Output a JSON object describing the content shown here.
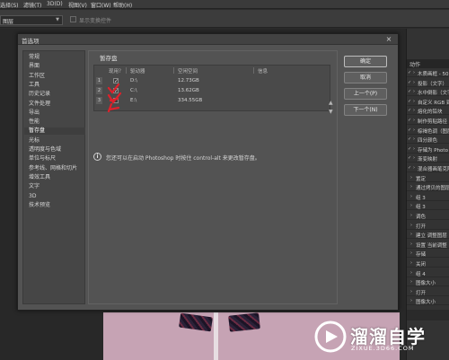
{
  "menubar": {
    "items": [
      "选择(S)",
      "滤镜(T)",
      "3D(D)",
      "视图(V)",
      "窗口(W)",
      "帮助(H)"
    ]
  },
  "options_bar": {
    "layer_select_value": "图层",
    "show_transform_label": "显示变换控件"
  },
  "dialog": {
    "title": "首选项",
    "close_label": "×",
    "categories": [
      "常规",
      "界面",
      "工作区",
      "工具",
      "历史记录",
      "文件处理",
      "导出",
      "性能",
      "暂存盘",
      "光标",
      "透明度与色域",
      "单位与标尺",
      "参考线、网格和切片",
      "增效工具",
      "文字",
      "3D",
      "技术预览"
    ],
    "selected_category": "暂存盘",
    "section_title": "暂存盘",
    "table": {
      "headers": [
        "现用？",
        "驱动器",
        "空闲空间",
        "信息"
      ],
      "rows": [
        {
          "num": "1",
          "checked": true,
          "drive": "D:\\",
          "free": "12.73GB",
          "info": ""
        },
        {
          "num": "2",
          "checked": true,
          "drive": "C:\\",
          "free": "13.62GB",
          "info": ""
        },
        {
          "num": "3",
          "checked": false,
          "drive": "E:\\",
          "free": "334.55GB",
          "info": ""
        }
      ],
      "arrow_up": "▲",
      "arrow_down": "▼"
    },
    "info_icon": "i",
    "info_text": "您还可以在启动 Photoshop 时按住 control-alt 来更改暂存盘。",
    "buttons": {
      "ok": "确定",
      "cancel": "取消",
      "prev": "上一个(P)",
      "next": "下一个(N)"
    },
    "annotation_color": "#e0202a"
  },
  "right_panel": {
    "tab_label": "动作",
    "items": [
      {
        "checked": true,
        "text": "木质画框 - 50"
      },
      {
        "checked": true,
        "text": "投影（文字）"
      },
      {
        "checked": true,
        "text": "水中倒影（文字）"
      },
      {
        "checked": true,
        "text": "自定义 RGB 到"
      },
      {
        "checked": true,
        "text": "熔化的铅块"
      },
      {
        "checked": true,
        "text": "制作剪贴路径"
      },
      {
        "checked": true,
        "text": "棕褐色调（图层"
      },
      {
        "checked": true,
        "text": "四分颜色"
      },
      {
        "checked": true,
        "text": "存储为 Photo"
      },
      {
        "checked": true,
        "text": "渐变映射"
      },
      {
        "checked": true,
        "text": "混合器画笔克隆"
      },
      {
        "checked": false,
        "text": "置定"
      },
      {
        "checked": false,
        "text": "通过拷贝的图层"
      },
      {
        "checked": false,
        "text": "组 3"
      },
      {
        "checked": false,
        "text": "组 3"
      },
      {
        "checked": false,
        "text": "调色"
      },
      {
        "checked": false,
        "text": "打开"
      },
      {
        "checked": false,
        "text": "建立 调整图层"
      },
      {
        "checked": false,
        "text": "设置 当前调整"
      },
      {
        "checked": false,
        "text": "存储"
      },
      {
        "checked": false,
        "text": "关闭"
      },
      {
        "checked": false,
        "text": "组 4"
      },
      {
        "checked": false,
        "text": "图像大小"
      },
      {
        "checked": false,
        "text": "打开"
      },
      {
        "checked": false,
        "text": "图像大小"
      }
    ]
  },
  "watermark": {
    "name": "溜溜自学",
    "url": "ZIXUE.3D66.COM"
  }
}
